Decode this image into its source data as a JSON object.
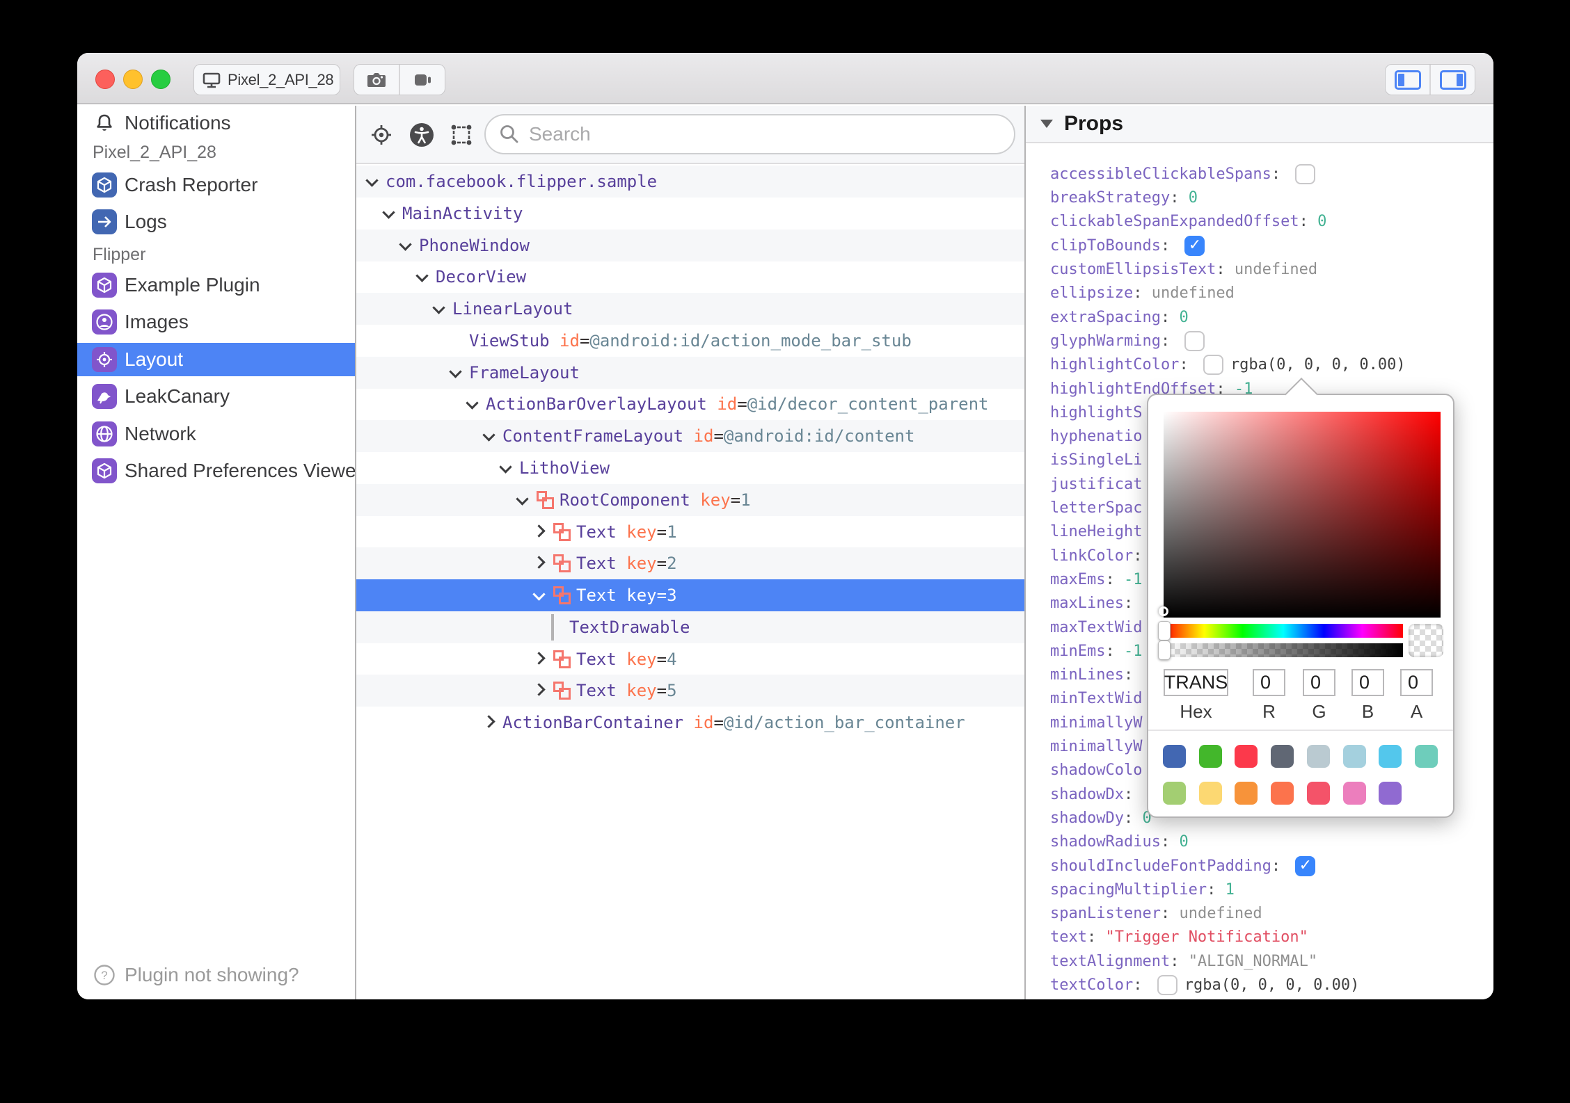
{
  "titlebar": {
    "device_label": "Pixel_2_API_28",
    "buttons": {
      "close": "close",
      "minimize": "minimize",
      "zoom": "zoom"
    },
    "tools": [
      "screenshot",
      "screen-record"
    ],
    "panel_toggles": [
      "toggle-left-panel",
      "toggle-right-panel"
    ]
  },
  "sidebar": {
    "header": {
      "label": "Notifications"
    },
    "sections": [
      {
        "label": "Pixel_2_API_28",
        "items": [
          {
            "label": "Crash Reporter",
            "icon": "cube",
            "color": "#4267b2"
          },
          {
            "label": "Logs",
            "icon": "arrow",
            "color": "#4267b2"
          }
        ]
      },
      {
        "label": "Flipper",
        "items": [
          {
            "label": "Example Plugin",
            "icon": "cube",
            "color": "#8155cb"
          },
          {
            "label": "Images",
            "icon": "images",
            "color": "#8155cb"
          },
          {
            "label": "Layout",
            "icon": "target",
            "color": "#8155cb",
            "selected": true
          },
          {
            "label": "LeakCanary",
            "icon": "bird",
            "color": "#8155cb"
          },
          {
            "label": "Network",
            "icon": "globe",
            "color": "#8155cb"
          },
          {
            "label": "Shared Preferences Viewer",
            "icon": "cube",
            "color": "#8155cb"
          }
        ]
      }
    ],
    "footer": {
      "label": "Plugin not showing?"
    }
  },
  "tree": {
    "search_placeholder": "Search",
    "rows": [
      {
        "level": 0,
        "chevron": "open",
        "name": "com.facebook.flipper.sample"
      },
      {
        "level": 1,
        "chevron": "open",
        "name": "MainActivity"
      },
      {
        "level": 2,
        "chevron": "open",
        "name": "PhoneWindow"
      },
      {
        "level": 3,
        "chevron": "open",
        "name": "DecorView"
      },
      {
        "level": 4,
        "chevron": "open",
        "name": "LinearLayout"
      },
      {
        "level": 5,
        "chevron": "none",
        "name": "ViewStub",
        "attr": {
          "key": "id",
          "value": "@android:id/action_mode_bar_stub"
        }
      },
      {
        "level": 5,
        "chevron": "open",
        "name": "FrameLayout"
      },
      {
        "level": 6,
        "chevron": "open",
        "name": "ActionBarOverlayLayout",
        "attr": {
          "key": "id",
          "value": "@id/decor_content_parent"
        }
      },
      {
        "level": 7,
        "chevron": "open",
        "name": "ContentFrameLayout",
        "attr": {
          "key": "id",
          "value": "@android:id/content"
        }
      },
      {
        "level": 8,
        "chevron": "open",
        "name": "LithoView"
      },
      {
        "level": 9,
        "chevron": "open",
        "litho": true,
        "name": "RootComponent",
        "attr": {
          "key": "key",
          "value": "1"
        }
      },
      {
        "level": 10,
        "chevron": "closed",
        "litho": true,
        "name": "Text",
        "attr": {
          "key": "key",
          "value": "1"
        }
      },
      {
        "level": 10,
        "chevron": "closed",
        "litho": true,
        "name": "Text",
        "attr": {
          "key": "key",
          "value": "2"
        }
      },
      {
        "level": 10,
        "chevron": "open",
        "litho": true,
        "name": "Text",
        "attr": {
          "key": "key",
          "value": "3"
        },
        "selected": true
      },
      {
        "level": 11,
        "chevron": "bar",
        "name": "TextDrawable"
      },
      {
        "level": 10,
        "chevron": "closed",
        "litho": true,
        "name": "Text",
        "attr": {
          "key": "key",
          "value": "4"
        }
      },
      {
        "level": 10,
        "chevron": "closed",
        "litho": true,
        "name": "Text",
        "attr": {
          "key": "key",
          "value": "5"
        }
      },
      {
        "level": 7,
        "chevron": "closed",
        "name": "ActionBarContainer",
        "attr": {
          "key": "id",
          "value": "@id/action_bar_container"
        }
      }
    ]
  },
  "props": {
    "title": "Props",
    "rows": [
      {
        "name": "accessibleClickableSpans",
        "colon": true,
        "checkbox": false
      },
      {
        "name": "breakStrategy",
        "colon": true,
        "value": "0",
        "vtype": "number"
      },
      {
        "name": "clickableSpanExpandedOffset",
        "colon": true,
        "value": "0",
        "vtype": "number"
      },
      {
        "name": "clipToBounds",
        "colon": true,
        "checkbox": true
      },
      {
        "name": "customEllipsisText",
        "colon": true,
        "value": "undefined",
        "vtype": "muted"
      },
      {
        "name": "ellipsize",
        "colon": true,
        "value": "undefined",
        "vtype": "muted"
      },
      {
        "name": "extraSpacing",
        "colon": true,
        "value": "0",
        "vtype": "number"
      },
      {
        "name": "glyphWarming",
        "colon": true,
        "checkbox": false
      },
      {
        "name": "highlightColor",
        "colon": true,
        "checkbox": false,
        "value": "rgba(0, 0, 0, 0.00)",
        "vtype": "plain"
      },
      {
        "name": "highlightEndOffset",
        "colon": true,
        "value": "-1",
        "vtype": "number"
      },
      {
        "name": "highlightS",
        "colon": false
      },
      {
        "name": "hyphenatio",
        "colon": false
      },
      {
        "name": "isSingleLi",
        "colon": false
      },
      {
        "name": "justificat",
        "colon": false
      },
      {
        "name": "letterSpac",
        "colon": false
      },
      {
        "name": "lineHeight",
        "colon": false
      },
      {
        "name": "linkColor",
        "colon": true
      },
      {
        "name": "maxEms",
        "colon": true,
        "value": "-1",
        "vtype": "number"
      },
      {
        "name": "maxLines",
        "colon": true
      },
      {
        "name": "maxTextWid",
        "colon": false
      },
      {
        "name": "minEms",
        "colon": true,
        "value": "-1",
        "vtype": "number"
      },
      {
        "name": "minLines",
        "colon": true
      },
      {
        "name": "minTextWid",
        "colon": false
      },
      {
        "name": "minimallyW",
        "colon": false
      },
      {
        "name": "minimallyW",
        "colon": false
      },
      {
        "name": "shadowColo",
        "colon": false
      },
      {
        "name": "shadowDx",
        "colon": true
      },
      {
        "name": "shadowDy",
        "colon": true,
        "value": "0",
        "vtype": "number"
      },
      {
        "name": "shadowRadius",
        "colon": true,
        "value": "0",
        "vtype": "number"
      },
      {
        "name": "shouldIncludeFontPadding",
        "colon": true,
        "checkbox": true
      },
      {
        "name": "spacingMultiplier",
        "colon": true,
        "value": "1",
        "vtype": "number"
      },
      {
        "name": "spanListener",
        "colon": true,
        "value": "undefined",
        "vtype": "muted"
      },
      {
        "name": "text",
        "colon": true,
        "value": "\"Trigger Notification\"",
        "vtype": "string"
      },
      {
        "name": "textAlignment",
        "colon": true,
        "value": "\"ALIGN_NORMAL\"",
        "vtype": "muted"
      },
      {
        "name": "textColor",
        "colon": true,
        "checkbox": false,
        "value": "rgba(0, 0, 0, 0.00)",
        "vtype": "plain"
      }
    ]
  },
  "color_picker": {
    "hex_value": "TRANS",
    "r": "0",
    "g": "0",
    "b": "0",
    "a": "0",
    "labels": {
      "hex": "Hex",
      "r": "R",
      "g": "G",
      "b": "B",
      "a": "A"
    },
    "swatches_row1": [
      "#4267b2",
      "#43b72b",
      "#fc394b",
      "#606774",
      "#bacad1",
      "#a4d0de",
      "#53c7ec",
      "#6ecdbb"
    ],
    "swatches_row2": [
      "#a3ce72",
      "#fcd872",
      "#f7933a",
      "#fc734c",
      "#f45369",
      "#ec7ebd",
      "#906ad1"
    ]
  },
  "colors": {
    "selection_blue": "#4d84f5",
    "plugin_purple": "#8155cb",
    "device_plugin_blue": "#4267b2",
    "tree_name": "#58409b",
    "tree_attr_key": "#fc734c",
    "tree_attr_value": "#698694",
    "prop_name": "#7b64c0",
    "prop_number": "#43b293",
    "prop_string": "#e14e62",
    "litho_icon": "#f5766d"
  }
}
